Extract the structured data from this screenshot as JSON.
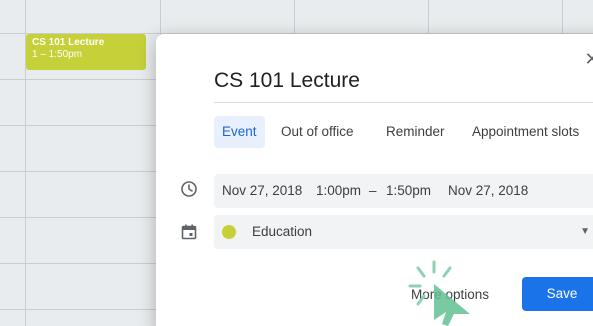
{
  "calendar": {
    "event_chip": {
      "title": "CS 101 Lecture",
      "time": "1 – 1:50pm",
      "color": "#c6d039"
    }
  },
  "dialog": {
    "close_icon": "close-icon",
    "title": "CS 101 Lecture",
    "tabs": [
      {
        "label": "Event",
        "active": true
      },
      {
        "label": "Out of office",
        "active": false
      },
      {
        "label": "Reminder",
        "active": false
      },
      {
        "label": "Appointment slots",
        "active": false
      }
    ],
    "datetime": {
      "start_date": "Nov 27, 2018",
      "start_time": "1:00pm",
      "separator": "–",
      "end_time": "1:50pm",
      "end_date": "Nov 27, 2018"
    },
    "calendar_select": {
      "value": "Education",
      "color": "#c6d039"
    },
    "buttons": {
      "more_options": "More options",
      "save": "Save"
    }
  },
  "colors": {
    "accent": "#1a73e8",
    "active_tab_bg": "#e8f0fe",
    "active_tab_text": "#1967d2"
  }
}
